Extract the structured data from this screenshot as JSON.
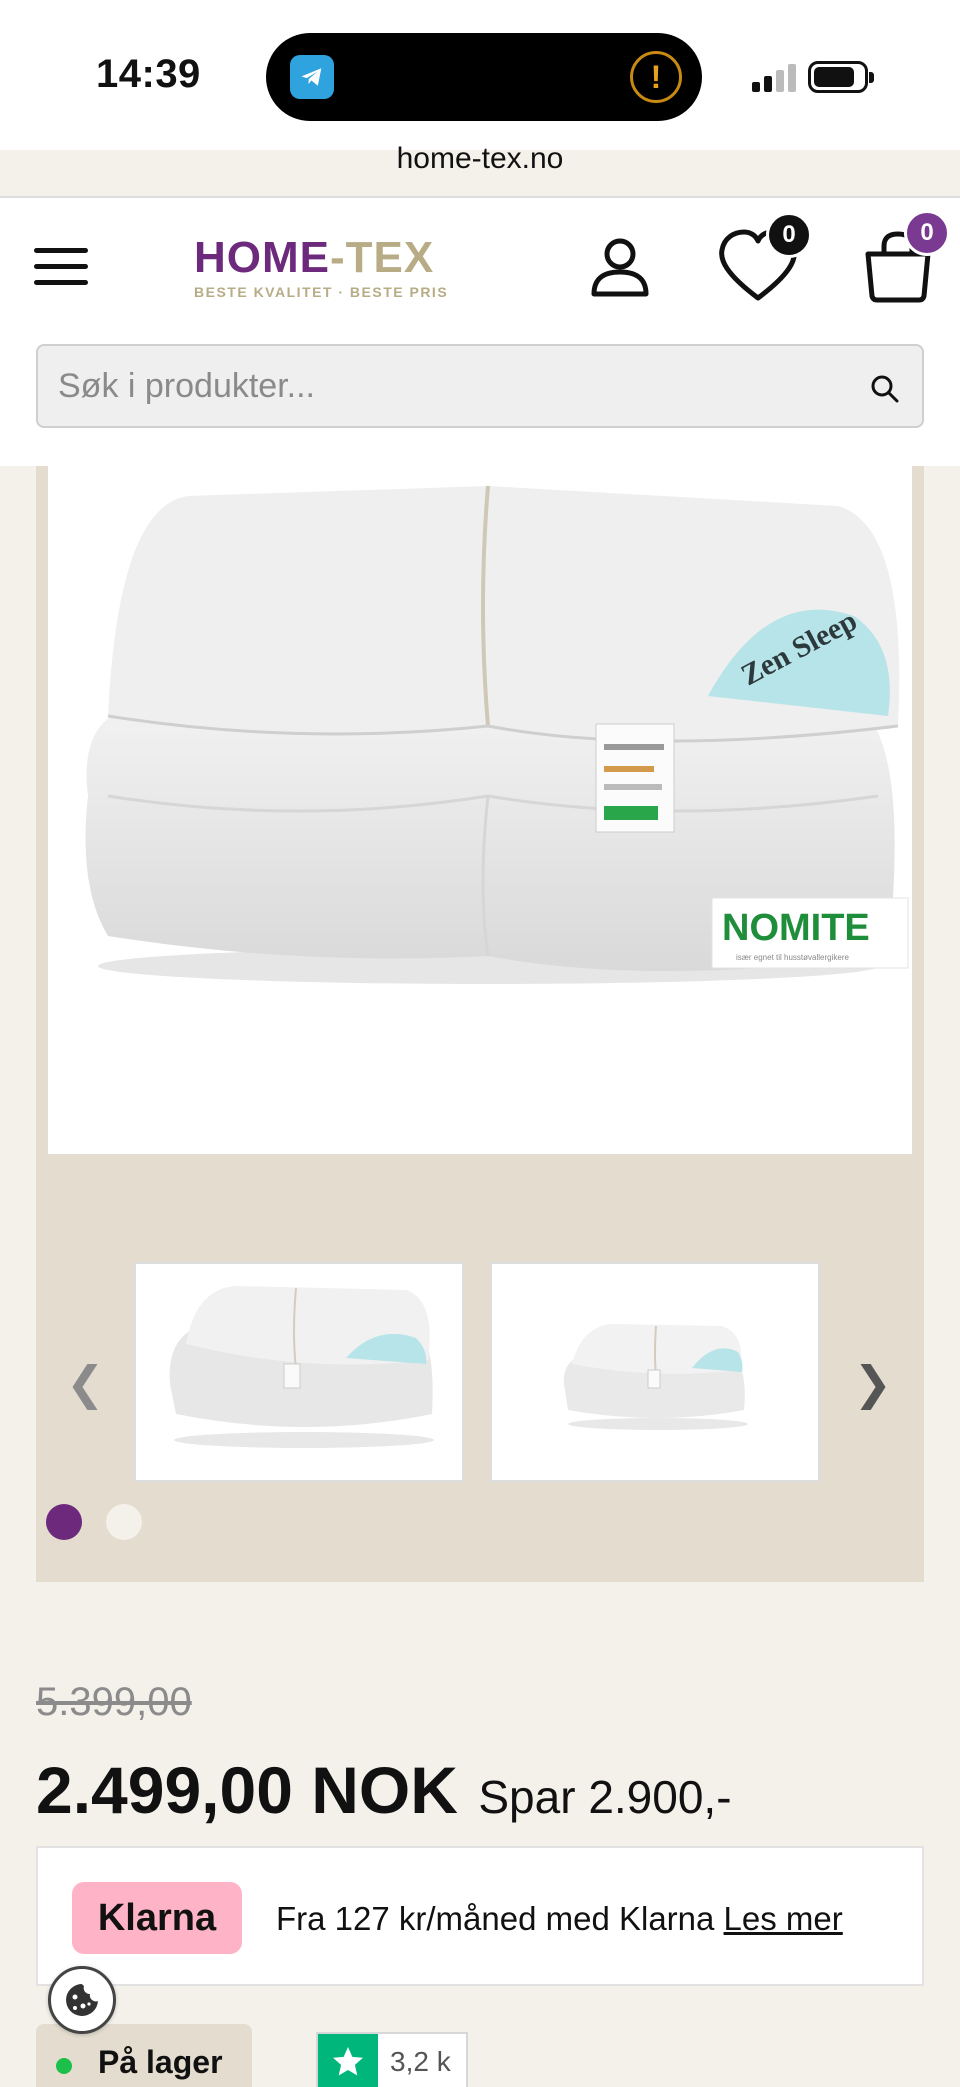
{
  "status_bar": {
    "time": "14:39",
    "alert_glyph": "!",
    "icons": [
      "telegram-icon",
      "alert-icon",
      "signal-icon",
      "battery-icon"
    ]
  },
  "browser": {
    "url": "home-tex.no"
  },
  "header": {
    "logo_main": "HOME",
    "logo_dash": "-TEX",
    "logo_tagline": "BESTE KVALITET · BESTE PRIS",
    "wishlist_count": "0",
    "cart_count": "0",
    "search_placeholder": "Søk i produkter...",
    "search_value": ""
  },
  "product_image": {
    "brand_label": "Zen Sleep",
    "cert_brand": "NOMITE",
    "cert_subtitle": "især egnet til husstøvallergikere"
  },
  "gallery": {
    "prev_glyph": "❮",
    "next_glyph": "❯",
    "active_slide": 1,
    "slide_count": 2
  },
  "pricing": {
    "old_price": "5.399,00",
    "current_price": "2.499,00 NOK",
    "savings": "Spar 2.900,-"
  },
  "klarna": {
    "badge": "Klarna",
    "text": "Fra 127 kr/måned med Klarna ",
    "link": "Les mer"
  },
  "stock": {
    "label": "På lager"
  },
  "trustpilot": {
    "count": "3,2 k"
  },
  "colors": {
    "brand_purple": "#6d2a7c",
    "brand_gold": "#b7ac86",
    "klarna_pink": "#ffb3c7",
    "in_stock_green": "#1bbf4a",
    "trustpilot_green": "#00b67a"
  }
}
